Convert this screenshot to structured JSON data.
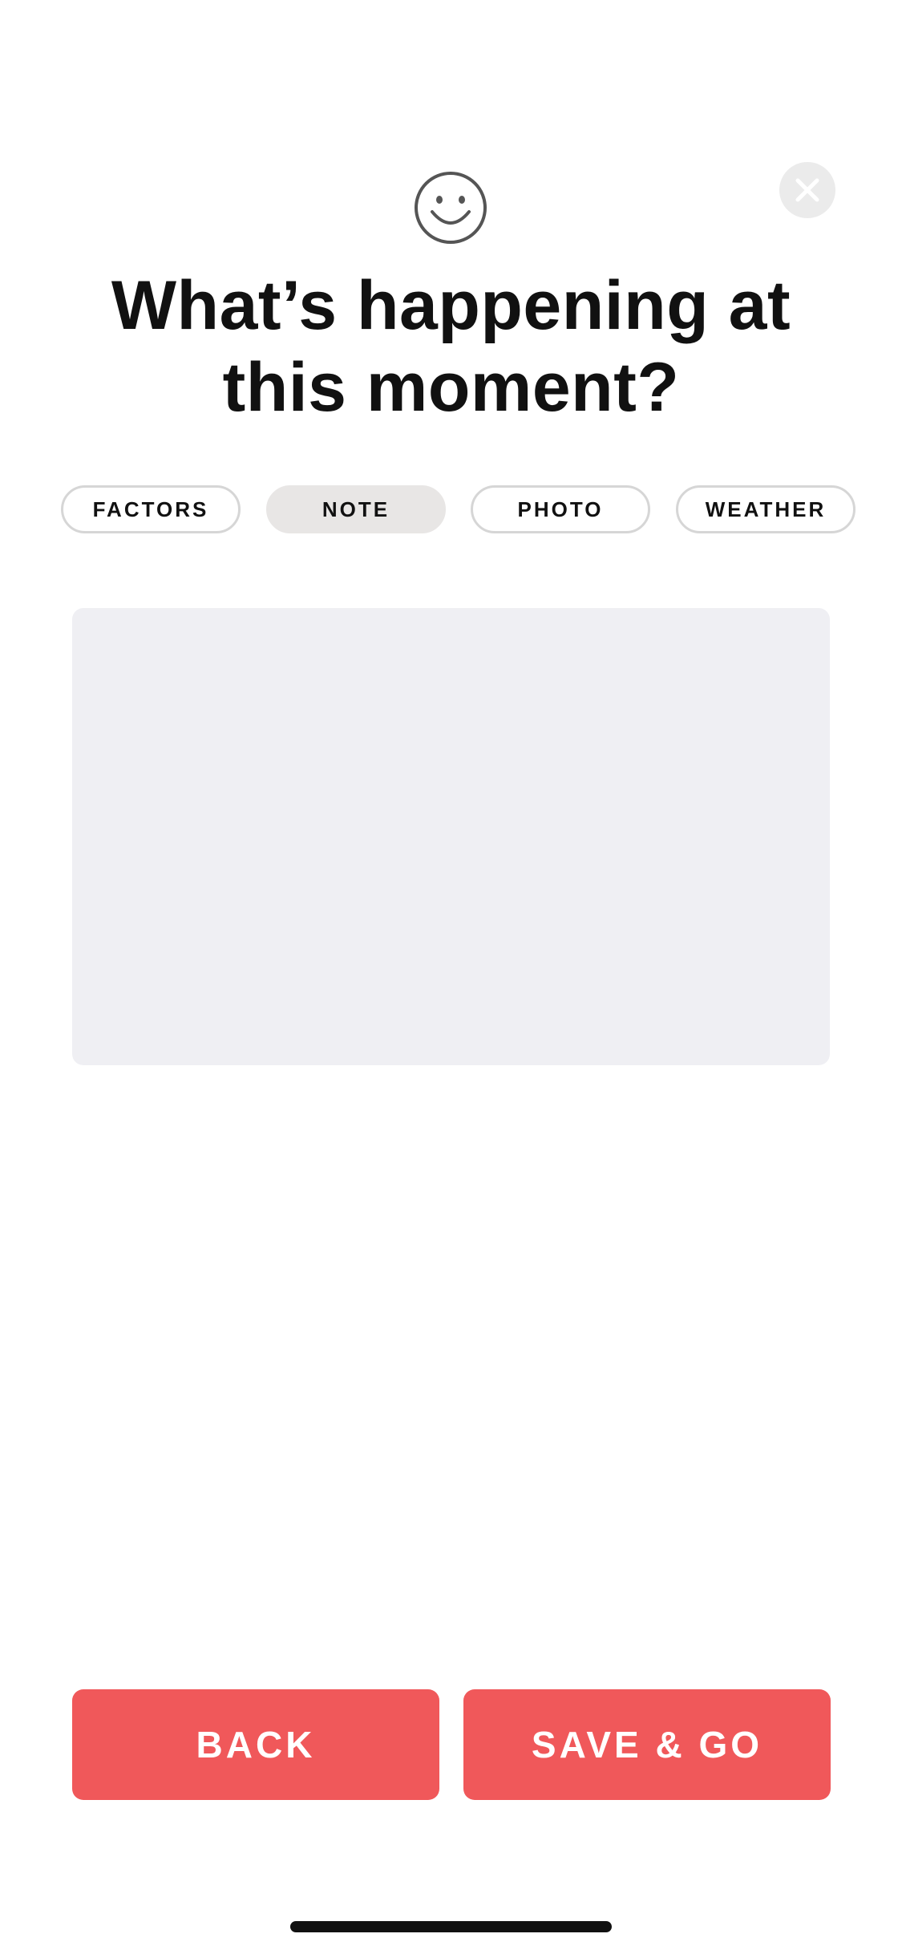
{
  "header": {
    "mood_icon": "smiley-face-icon",
    "close_icon": "close-x-icon",
    "title": "What’s happening at\nthis moment?"
  },
  "tabs": [
    {
      "label": "FACTORS",
      "active": false
    },
    {
      "label": "NOTE",
      "active": true
    },
    {
      "label": "PHOTO",
      "active": false
    },
    {
      "label": "WEATHER",
      "active": false
    }
  ],
  "note": {
    "value": "",
    "placeholder": ""
  },
  "actions": {
    "back_label": "BACK",
    "save_label": "SAVE & GO"
  },
  "colors": {
    "accent": "#f0585a",
    "active_tab_bg": "#e8e6e5",
    "note_bg": "#efeff3",
    "close_bg": "#ebebeb"
  }
}
